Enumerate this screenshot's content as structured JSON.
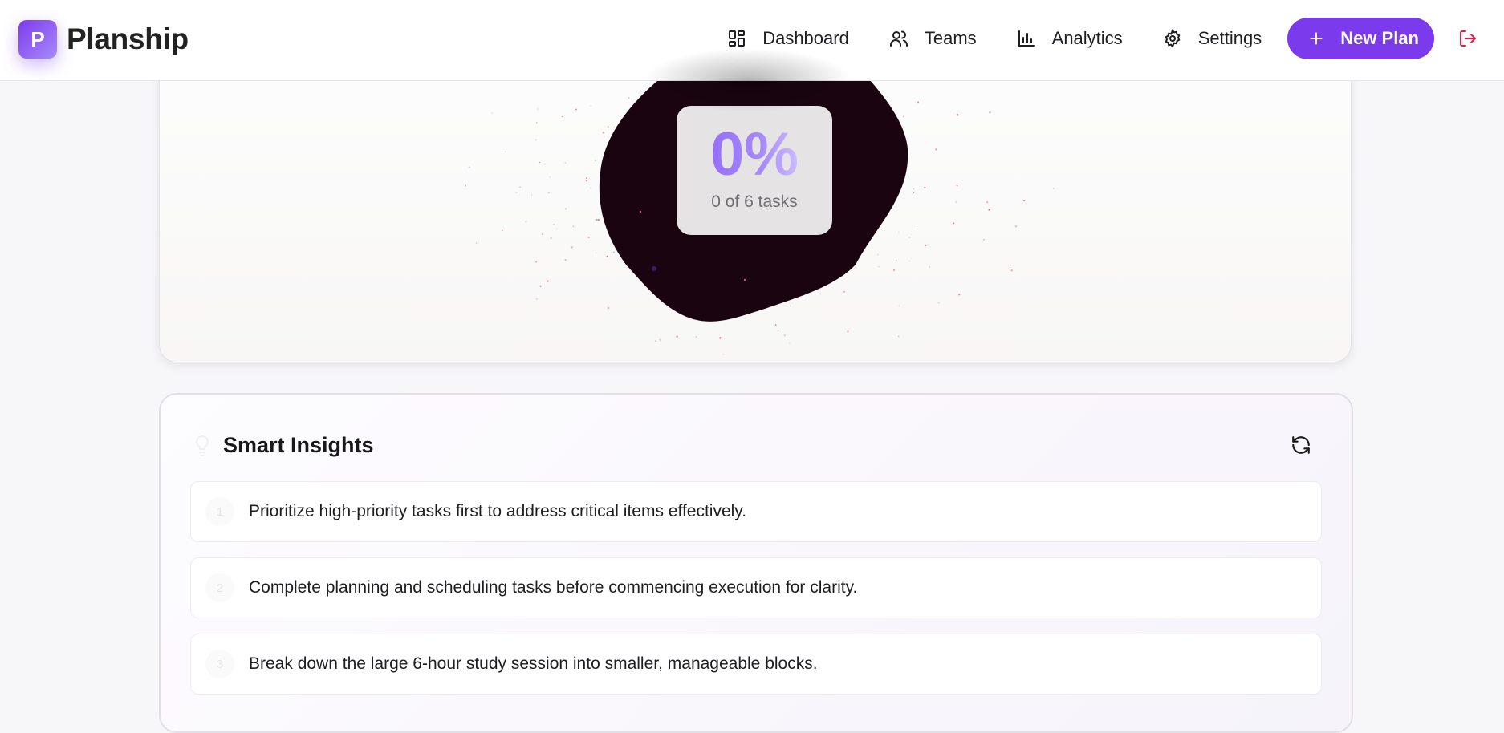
{
  "app": {
    "logo_letter": "P",
    "name": "Planship"
  },
  "nav": {
    "items": [
      {
        "label": "Dashboard",
        "icon": "grid-icon"
      },
      {
        "label": "Teams",
        "icon": "users-icon"
      },
      {
        "label": "Analytics",
        "icon": "bar-chart-icon"
      },
      {
        "label": "Settings",
        "icon": "gear-icon"
      }
    ],
    "new_plan_label": "New Plan",
    "new_plan_icon": "plus-icon",
    "logout_icon": "logout-icon"
  },
  "progress": {
    "percent_label": "0%",
    "percent": 0,
    "tasks_label": "0 of 6 tasks",
    "completed": 0,
    "total": 6
  },
  "insights": {
    "title": "Smart Insights",
    "title_icon": "lightbulb-icon",
    "refresh_icon": "refresh-icon",
    "items": [
      {
        "num": "1",
        "text": "Prioritize high-priority tasks first to address critical items effectively."
      },
      {
        "num": "2",
        "text": "Complete planning and scheduling tasks before commencing execution for clarity."
      },
      {
        "num": "3",
        "text": "Break down the large 6-hour study session into smaller, manageable blocks."
      }
    ]
  },
  "colors": {
    "accent": "#7c3aed",
    "logout": "#e11d48",
    "blob": "#1a0410",
    "particles": "#d94b6b"
  }
}
